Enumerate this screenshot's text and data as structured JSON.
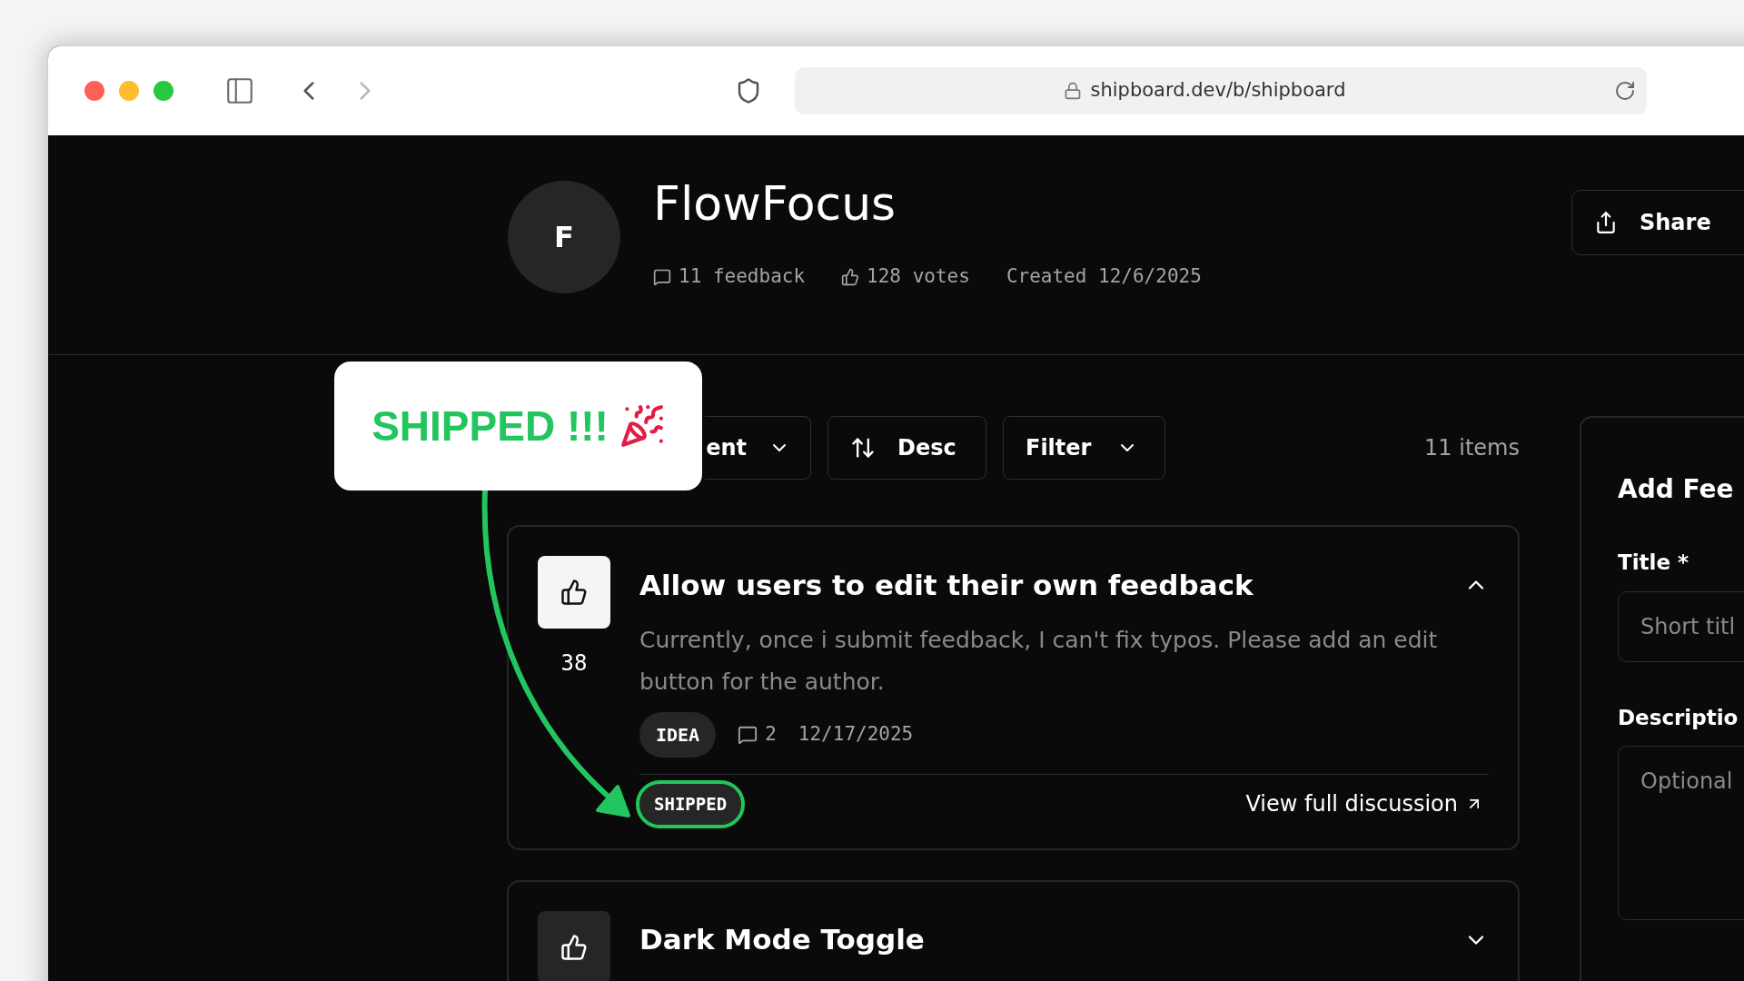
{
  "browser": {
    "url": "shipboard.dev/b/shipboard"
  },
  "board": {
    "avatar_letter": "F",
    "name": "FlowFocus",
    "share_label": "Share",
    "stats": [
      {
        "kind": "feedback",
        "text": "11 feedback"
      },
      {
        "kind": "votes",
        "text": "128 votes"
      },
      {
        "kind": "created",
        "text": "Created 12/6/2025"
      }
    ]
  },
  "toolbar": {
    "sort_label": "ent",
    "order_label": "Desc",
    "filter_label": "Filter",
    "count": "11 items"
  },
  "callout": {
    "text": "SHIPPED !!!"
  },
  "feedback": [
    {
      "title": "Allow users to edit their own feedback",
      "votes": "38",
      "voted": true,
      "expanded": true,
      "description": "Currently, once i submit feedback, I can't fix typos. Please add an edit button for the author.",
      "tag": "IDEA",
      "comments": "2",
      "date": "12/17/2025",
      "status": "SHIPPED",
      "highlighted": true,
      "link": "View full discussion"
    },
    {
      "title": "Dark Mode Toggle",
      "voted": false,
      "expanded": false
    }
  ],
  "form": {
    "heading": "Add Fee",
    "title_label": "Title *",
    "title_placeholder": "Short titl",
    "description_label": "Descriptio",
    "description_placeholder": "Optional"
  }
}
